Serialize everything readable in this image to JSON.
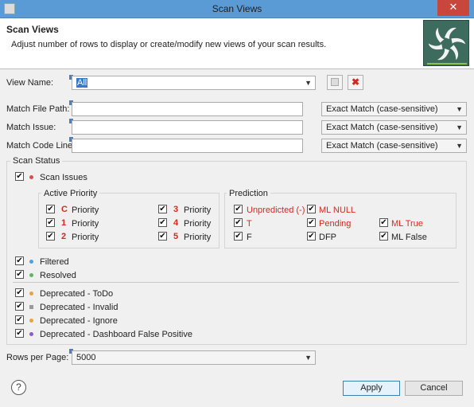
{
  "window": {
    "title": "Scan Views",
    "close_glyph": "✕"
  },
  "header": {
    "title": "Scan Views",
    "description": "Adjust number of rows to display or create/modify new views of your scan results.",
    "logo_icon": "pinwheel-logo-icon"
  },
  "view_name": {
    "label": "View Name:",
    "value": "All"
  },
  "filters": {
    "match_file_path": {
      "label": "Match File Path:",
      "value": "",
      "mode": "Exact Match (case-sensitive)"
    },
    "match_issue": {
      "label": "Match Issue:",
      "value": "",
      "mode": "Exact Match (case-sensitive)"
    },
    "match_code_line": {
      "label": "Match Code Line:",
      "value": "",
      "mode": "Exact Match (case-sensitive)"
    }
  },
  "scan_status": {
    "title": "Scan Status",
    "scan_issues": {
      "label": "Scan Issues",
      "checked": true,
      "dot_color": "#e04a4a"
    },
    "active_priority": {
      "title": "Active Priority",
      "items": [
        {
          "letter": "C",
          "label": "Priority",
          "checked": true
        },
        {
          "letter": "1",
          "label": "Priority",
          "checked": true
        },
        {
          "letter": "2",
          "label": "Priority",
          "checked": true
        },
        {
          "letter": "3",
          "label": "Priority",
          "checked": true
        },
        {
          "letter": "4",
          "label": "Priority",
          "checked": true
        },
        {
          "letter": "5",
          "label": "Priority",
          "checked": true
        }
      ]
    },
    "prediction": {
      "title": "Prediction",
      "items": [
        {
          "label": "Unpredicted (-)",
          "checked": true,
          "red": true
        },
        {
          "label": "ML NULL",
          "checked": true,
          "red": true
        },
        {
          "label": "T",
          "checked": true,
          "red": true
        },
        {
          "label": "Pending",
          "checked": true,
          "red": true
        },
        {
          "label": "ML True",
          "checked": true,
          "red": true
        },
        {
          "label": "F",
          "checked": true,
          "red": false
        },
        {
          "label": "DFP",
          "checked": true,
          "red": false
        },
        {
          "label": "ML False",
          "checked": true,
          "red": false
        }
      ]
    },
    "filtered": {
      "label": "Filtered",
      "checked": true,
      "dot_color": "#4aa3e0"
    },
    "resolved": {
      "label": "Resolved",
      "checked": true,
      "dot_color": "#5cb85c"
    },
    "deprecated": [
      {
        "label": "Deprecated - ToDo",
        "checked": true,
        "dot_color": "#e8a33d"
      },
      {
        "label": "Deprecated - Invalid",
        "checked": true,
        "dot_color": "#9a9a9a"
      },
      {
        "label": "Deprecated - Ignore",
        "checked": true,
        "dot_color": "#e8a33d"
      },
      {
        "label": "Deprecated - Dashboard False Positive",
        "checked": true,
        "dot_color": "#8b5cc8"
      }
    ]
  },
  "rows_per_page": {
    "label": "Rows per Page:",
    "value": "5000"
  },
  "footer": {
    "help": "?",
    "apply": "Apply",
    "cancel": "Cancel"
  },
  "check_glyph": "✔"
}
